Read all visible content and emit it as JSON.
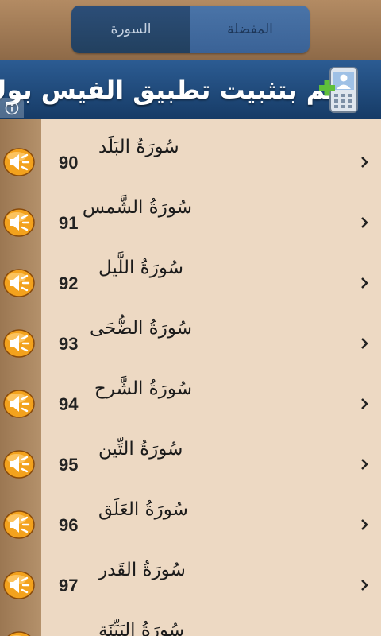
{
  "tabs": {
    "surah_label": "السورة",
    "favorites_label": "المفضلة"
  },
  "banner": {
    "text": "قم بتثبيت تطبيق الفيس بوك",
    "info_label": "i"
  },
  "surahs": [
    {
      "number": "90",
      "name": "سُورَةُ البَلَد"
    },
    {
      "number": "91",
      "name": "سُورَةُ الشَّمس"
    },
    {
      "number": "92",
      "name": "سُورَةُ اللَّيل"
    },
    {
      "number": "93",
      "name": "سُورَةُ الضُّحَى"
    },
    {
      "number": "94",
      "name": "سُورَةُ الشَّرح"
    },
    {
      "number": "95",
      "name": "سُورَةُ التِّين"
    },
    {
      "number": "96",
      "name": "سُورَةُ العَلَق"
    },
    {
      "number": "97",
      "name": "سُورَةُ القَدر"
    },
    {
      "number": "",
      "name": "سُورَةُ البَيِّنَة"
    }
  ],
  "colors": {
    "list_background": "#edd9c3",
    "header_brown": "#a07b56",
    "tab_selected_blue": "#2c4e78",
    "tab_blue": "#4a74a8",
    "speaker_orange": "#f5a623"
  }
}
